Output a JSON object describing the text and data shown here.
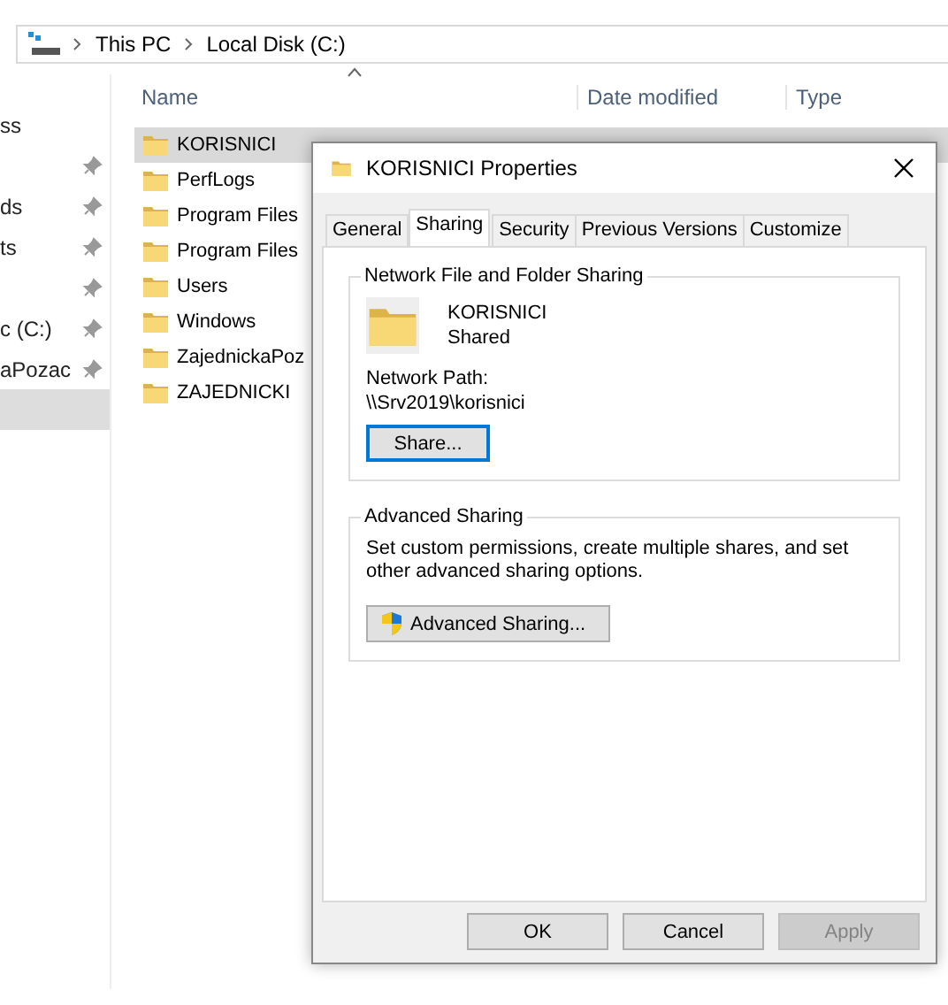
{
  "explorer": {
    "breadcrumb": [
      "This PC",
      "Local Disk (C:)"
    ],
    "columns": [
      "Name",
      "Date modified",
      "Type"
    ],
    "nav_items": [
      {
        "label": "ss",
        "pinned": false,
        "selected": false
      },
      {
        "pinned": true,
        "selected": false
      },
      {
        "label": "ds",
        "pinned": true,
        "selected": false
      },
      {
        "label": "ts",
        "pinned": true,
        "selected": false
      },
      {
        "pinned": true,
        "selected": false
      },
      {
        "label": "c (C:)",
        "pinned": true,
        "selected": false
      },
      {
        "label": "aPozac",
        "pinned": true,
        "selected": false
      },
      {
        "pinned": false,
        "selected": true
      }
    ],
    "files": [
      {
        "name": "KORISNICI",
        "selected": true
      },
      {
        "name": "PerfLogs",
        "selected": false
      },
      {
        "name": "Program Files",
        "selected": false
      },
      {
        "name": "Program Files",
        "selected": false
      },
      {
        "name": "Users",
        "selected": false
      },
      {
        "name": "Windows",
        "selected": false
      },
      {
        "name": "ZajednickaPoz",
        "selected": false
      },
      {
        "name": "ZAJEDNICKI",
        "selected": false
      }
    ]
  },
  "dialog": {
    "title": "KORISNICI Properties",
    "tabs": [
      {
        "label": "General",
        "selected": false
      },
      {
        "label": "Sharing",
        "selected": true
      },
      {
        "label": "Security",
        "selected": false
      },
      {
        "label": "Previous Versions",
        "selected": false
      },
      {
        "label": "Customize",
        "selected": false
      }
    ],
    "network_sharing": {
      "title": "Network File and Folder Sharing",
      "folder_name": "KORISNICI",
      "status": "Shared",
      "path_label": "Network Path:",
      "path": "\\\\Srv2019\\korisnici",
      "button": {
        "label": "Share...",
        "focused": true
      }
    },
    "advanced_sharing": {
      "title": "Advanced Sharing",
      "description": "Set custom permissions, create multiple shares, and set other advanced sharing options.",
      "button": {
        "label": "Advanced Sharing...",
        "focused": false
      }
    },
    "buttons": [
      {
        "label": "OK",
        "disabled": false
      },
      {
        "label": "Cancel",
        "disabled": false
      },
      {
        "label": "Apply",
        "disabled": true
      }
    ]
  }
}
